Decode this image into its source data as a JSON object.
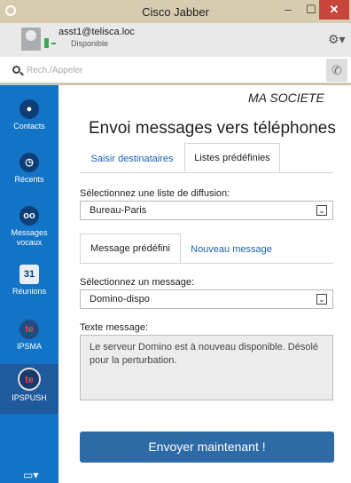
{
  "window": {
    "title": "Cisco Jabber",
    "min_glyph": "–",
    "max_glyph": "☐",
    "close_glyph": "✕"
  },
  "user": {
    "id": "asst1@telisca.loc",
    "status": "Disponible",
    "presence_color": "#3aa655",
    "settings_glyph": "⚙▾"
  },
  "search": {
    "placeholder": "Rech./Appeler",
    "call_glyph": "✆"
  },
  "sidebar": {
    "items": [
      {
        "label": "Contacts",
        "icon": "person-icon",
        "glyph": "●"
      },
      {
        "label": "Récents",
        "icon": "clock-icon",
        "glyph": "◷"
      },
      {
        "label": "Messages vocaux",
        "icon": "voicemail-icon",
        "glyph": "oo"
      },
      {
        "label": "Réunions",
        "icon": "calendar-icon",
        "glyph": "31"
      },
      {
        "label": "IPSMA",
        "icon": "ipsma-icon",
        "glyph": "te"
      },
      {
        "label": "IPSPUSH",
        "icon": "ipspush-icon",
        "glyph": "te"
      }
    ],
    "screen_share_glyph": "▭▾"
  },
  "main": {
    "company": "MA SOCIETE",
    "heading": "Envoi messages vers téléphones",
    "tabs_top": [
      "Saisir destinataires",
      "Listes prédéfinies"
    ],
    "list_label": "Sélectionnez une liste de diffusion:",
    "list_value": "Bureau-Paris",
    "tabs_message": [
      "Message prédéfini",
      "Nouveau message"
    ],
    "message_label": "Sélectionnez un message:",
    "message_value": "Domino-dispo",
    "text_label": "Texte message:",
    "text_value": "Le serveur Domino est à nouveau disponible. Désolé pour la perturbation.",
    "send_label": "Envoyer maintenant !",
    "dropdown_glyph": "⌄",
    "accent": "#1a63b0",
    "send_color": "#2d6aa6"
  }
}
